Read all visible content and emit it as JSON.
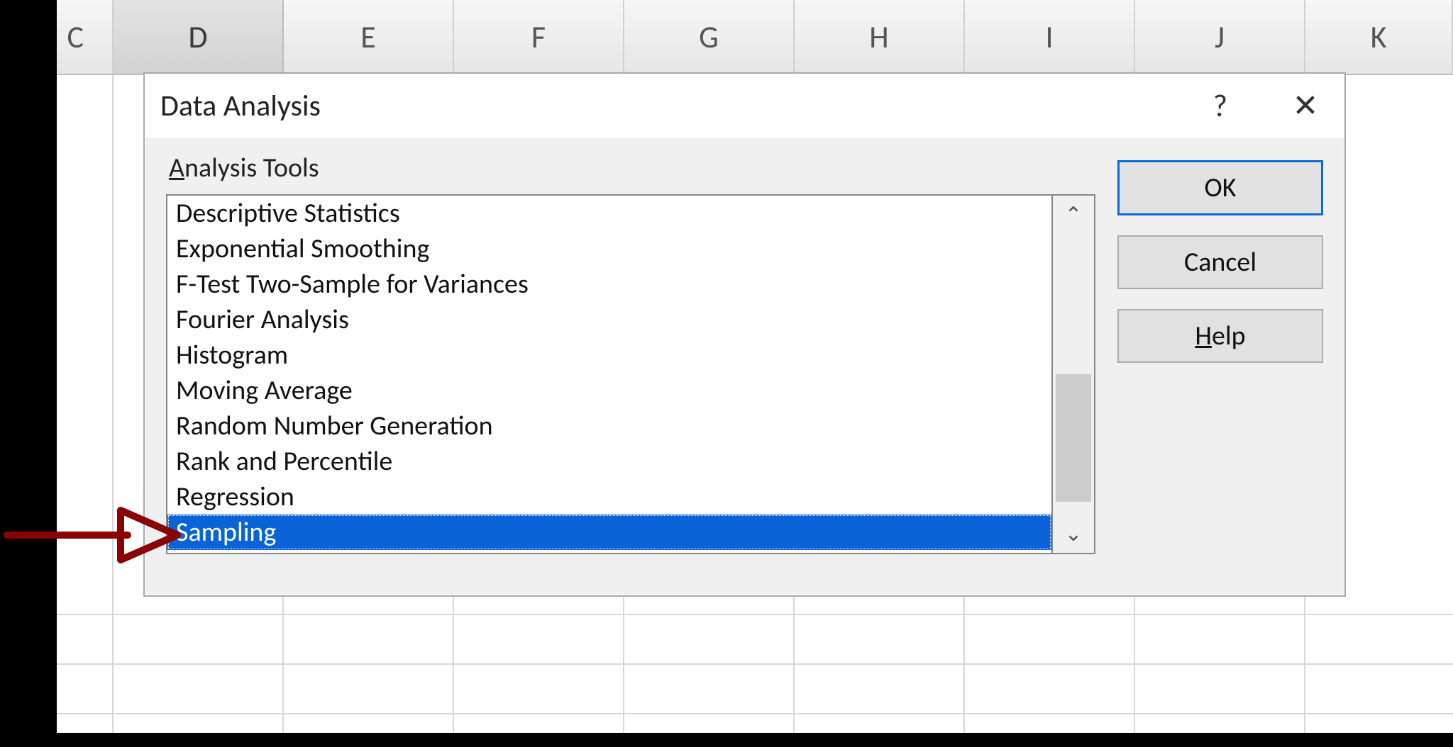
{
  "spreadsheet": {
    "columns": [
      "C",
      "D",
      "E",
      "F",
      "G",
      "H",
      "I",
      "J",
      "K"
    ],
    "active_column": "D"
  },
  "dialog": {
    "title": "Data Analysis",
    "help_icon_label": "?",
    "close_icon_label": "✕",
    "section_label_pre": "A",
    "section_label_rest": "nalysis Tools",
    "tools": [
      "Descriptive Statistics",
      "Exponential Smoothing",
      "F-Test Two-Sample for Variances",
      "Fourier Analysis",
      "Histogram",
      "Moving Average",
      "Random Number Generation",
      "Rank and Percentile",
      "Regression",
      "Sampling"
    ],
    "selected_index": 9,
    "buttons": {
      "ok": "OK",
      "cancel": "Cancel",
      "help_pre": "H",
      "help_rest": "elp"
    },
    "scroll": {
      "up_glyph": "⌃",
      "down_glyph": "⌄"
    }
  }
}
